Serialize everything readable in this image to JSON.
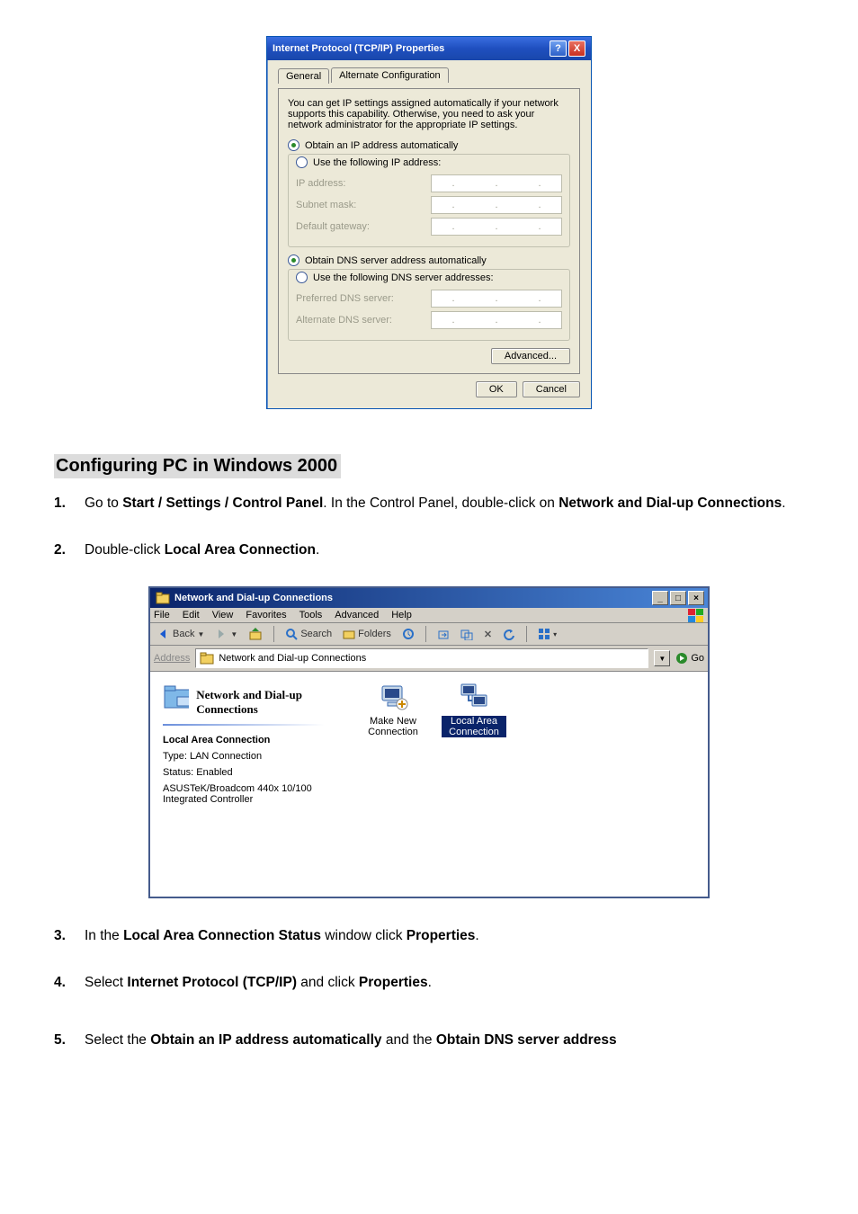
{
  "tcpip_dialog": {
    "title": "Internet Protocol (TCP/IP) Properties",
    "tabs": {
      "general": "General",
      "alt": "Alternate Configuration"
    },
    "explain": "You can get IP settings assigned automatically if your network supports this capability. Otherwise, you need to ask your network administrator for the appropriate IP settings.",
    "radio_ip_auto": "Obtain an IP address automatically",
    "radio_ip_manual": "Use the following IP address:",
    "lbl_ip": "IP address:",
    "lbl_subnet": "Subnet mask:",
    "lbl_gateway": "Default gateway:",
    "radio_dns_auto": "Obtain DNS server address automatically",
    "radio_dns_manual": "Use the following DNS server addresses:",
    "lbl_pref_dns": "Preferred DNS server:",
    "lbl_alt_dns": "Alternate DNS server:",
    "btn_advanced": "Advanced...",
    "btn_ok": "OK",
    "btn_cancel": "Cancel",
    "help_glyph": "?",
    "close_glyph": "X"
  },
  "heading": "Configuring PC in Windows 2000",
  "steps": {
    "s1_num": "1.",
    "s1_a": "Go to ",
    "s1_b": "Start / Settings / Control Panel",
    "s1_c": ". In the Control Panel, double-click on ",
    "s1_d": "Network and Dial-up Connections",
    "s1_e": ".",
    "s2_num": "2.",
    "s2_a": "Double-click ",
    "s2_b": "Local Area Connection",
    "s2_c": ".",
    "s3_num": "3.",
    "s3_a": "In the ",
    "s3_b": "Local Area Connection Status",
    "s3_c": " window click ",
    "s3_d": "Properties",
    "s3_e": ".",
    "s4_num": "4.",
    "s4_a": "Select ",
    "s4_b": "Internet Protocol (TCP/IP)",
    "s4_c": " and click ",
    "s4_d": "Properties",
    "s4_e": ".",
    "s5_num": "5.",
    "s5_a": "Select the ",
    "s5_b": "Obtain an IP address automatically",
    "s5_c": " and the ",
    "s5_d": "Obtain DNS server address"
  },
  "win2k": {
    "title": "Network and Dial-up Connections",
    "min": "_",
    "max": "□",
    "close": "×",
    "menu": {
      "file": "File",
      "edit": "Edit",
      "view": "View",
      "favorites": "Favorites",
      "tools": "Tools",
      "advanced": "Advanced",
      "help": "Help"
    },
    "toolbar": {
      "back": "Back",
      "search": "Search",
      "folders": "Folders"
    },
    "address_label": "Address",
    "address_value": "Network and Dial-up Connections",
    "go": "Go",
    "dd_glyph": "▼",
    "left": {
      "title": "Network and Dial-up Connections",
      "lac_heading": "Local Area Connection",
      "type": "Type: LAN Connection",
      "status": "Status: Enabled",
      "device": "ASUSTeK/Broadcom 440x 10/100 Integrated Controller"
    },
    "icons": {
      "make_new": "Make New Connection",
      "lac": "Local Area Connection"
    }
  }
}
